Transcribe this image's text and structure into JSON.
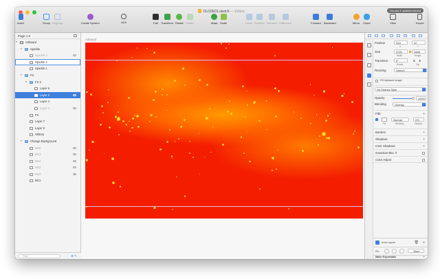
{
  "window": {
    "document_title": "OLO2E01.sketch",
    "edited_label": "— Edited",
    "update_notice": "You are 4 updates behind"
  },
  "toolbar": {
    "insert": "Insert",
    "group": "Group",
    "ungroup": "Ungroup",
    "create_symbol": "Create Symbol",
    "zoom": "44%",
    "edit": "Edit",
    "transform": "Transform",
    "rotate": "Rotate",
    "flatten": "Flatten",
    "mask": "Mask",
    "scale": "Scale",
    "union": "Union",
    "subtract": "Subtract",
    "intersect": "Intersect",
    "difference": "Difference",
    "forward": "Forward",
    "backward": "Backward",
    "mirror": "Mirror",
    "cloud": "Cloud",
    "view": "View",
    "export": "Export"
  },
  "sidebar": {
    "page": "Page 1",
    "filter_placeholder": "Filter",
    "layers": [
      {
        "label": "Artboard",
        "kind": "board",
        "depth": 0,
        "state": "normal"
      },
      {
        "label": "Sparkle",
        "kind": "folder",
        "depth": 1,
        "state": "normal"
      },
      {
        "label": "Sparkle 3",
        "kind": "layer",
        "depth": 2,
        "state": "hidden"
      },
      {
        "label": "Sparkle 2",
        "kind": "layer",
        "depth": 2,
        "state": "outlined"
      },
      {
        "label": "Sparkle 1",
        "kind": "layer",
        "depth": 2,
        "state": "normal"
      },
      {
        "label": "FX",
        "kind": "folder",
        "depth": 1,
        "state": "normal"
      },
      {
        "label": "FX 2",
        "kind": "folder",
        "depth": 2,
        "state": "normal"
      },
      {
        "label": "Layer 6",
        "kind": "layer",
        "depth": 3,
        "state": "normal"
      },
      {
        "label": "Layer 5",
        "kind": "layer",
        "depth": 3,
        "state": "selected"
      },
      {
        "label": "Layer 4",
        "kind": "layer",
        "depth": 3,
        "state": "normal"
      },
      {
        "label": "Layer 3",
        "kind": "layer",
        "depth": 3,
        "state": "hidden"
      },
      {
        "label": "FX",
        "kind": "layer",
        "depth": 2,
        "state": "normal"
      },
      {
        "label": "Layer 7",
        "kind": "layer",
        "depth": 2,
        "state": "normal"
      },
      {
        "label": "Layer 8",
        "kind": "layer",
        "depth": 2,
        "state": "normal"
      },
      {
        "label": "Glittery",
        "kind": "layer",
        "depth": 2,
        "state": "normal"
      },
      {
        "label": "Change Background",
        "kind": "folder",
        "depth": 1,
        "state": "normal"
      },
      {
        "label": "BG5",
        "kind": "layer",
        "depth": 2,
        "state": "hidden"
      },
      {
        "label": "BG3",
        "kind": "layer",
        "depth": 2,
        "state": "hidden"
      },
      {
        "label": "BG4",
        "kind": "layer",
        "depth": 2,
        "state": "hidden"
      },
      {
        "label": "BG3",
        "kind": "layer",
        "depth": 2,
        "state": "hidden"
      },
      {
        "label": "BG2",
        "kind": "layer",
        "depth": 2,
        "state": "hidden"
      },
      {
        "label": "BG1",
        "kind": "layer",
        "depth": 2,
        "state": "normal"
      }
    ]
  },
  "canvas": {
    "artboard_label": "Artboard"
  },
  "inspector": {
    "position_label": "Position",
    "pos_x": "318",
    "pos_y": "22",
    "x_label": "X",
    "y_label": "Y",
    "size_label": "Size",
    "width": "2220",
    "height": "1568",
    "width_label": "Width",
    "height_label": "Height",
    "transform_label": "Transform",
    "rotate_value": "0°",
    "rotate_label": "Rotate",
    "flip_label": "Flip",
    "resizing_label": "Resizing",
    "resizing_value": "Stretch",
    "fill_replaces_label": "Fill replaces image",
    "shared_style": "No Shared Style",
    "opacity_label": "Opacity",
    "opacity_value": "100%",
    "blending_label": "Blending",
    "blending_value": "Overlay",
    "fills_label": "Fills",
    "fill_blend": "Normal",
    "fill_opacity": "0%",
    "fill_col": "Fill",
    "blending_col": "Blending",
    "opacity_col": "Opacity",
    "borders": "Borders",
    "shadows": "Shadows",
    "inner_shadows": "Inner Shadows",
    "gaussian_blur": "Gaussian Blur",
    "color_adjust": "Color Adjust",
    "auto_layout": "Auto Layout",
    "pin_label": "Pin",
    "more_label": "More",
    "make_exportable": "Make Exportable"
  },
  "colors": {
    "selection": "#3f7fde",
    "canvas_red": "#f41d00",
    "glow_orange": "#ff9a00",
    "sparkle_yellow": "#ffd200"
  }
}
